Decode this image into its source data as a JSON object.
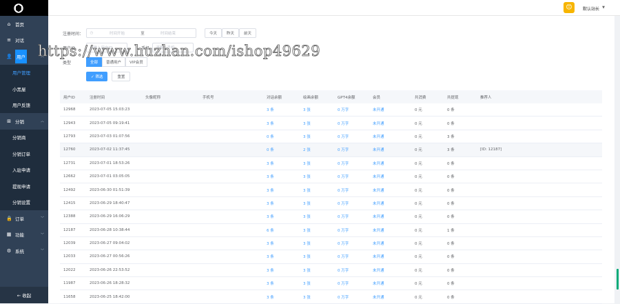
{
  "sidebar": {
    "items": [
      {
        "icon": "home-icon",
        "glyph": "⌂",
        "label": "首页"
      },
      {
        "icon": "list-icon",
        "glyph": "≡",
        "label": "对话"
      },
      {
        "icon": "user-icon",
        "glyph": "👤",
        "label": "用户",
        "expanded": true
      },
      {
        "icon": "distribution-icon",
        "glyph": "⊞",
        "label": "分销",
        "expanded": true
      },
      {
        "icon": "order-icon",
        "glyph": "🔒",
        "label": "订单"
      },
      {
        "icon": "function-icon",
        "glyph": "▦",
        "label": "功能"
      },
      {
        "icon": "system-icon",
        "glyph": "⚙",
        "label": "系统"
      }
    ],
    "user_sub": [
      "用户管理",
      "小黑屋",
      "用户反馈"
    ],
    "dist_sub": [
      "分销商",
      "分销订单",
      "入驻申请",
      "提现申请",
      "分销设置"
    ],
    "collapse_label": "← 收起"
  },
  "header": {
    "avatar_glyph": "😊",
    "username": "默认站长",
    "dropdown_glyph": "▼"
  },
  "filter": {
    "reg_time_label": "注册时间：",
    "start_placeholder": "时间开始",
    "separator": "至",
    "end_placeholder": "时间结束",
    "quick": [
      "今天",
      "昨天",
      "前天"
    ],
    "uid_label": "用户ID",
    "uid_placeholder": "请输入用户ID",
    "phone_label": "手机",
    "phone_placeholder": "请输入手机",
    "type_label": "类型",
    "type_options": [
      "全部",
      "普通用户",
      "VIP会员"
    ],
    "search_label": "✓ 筛选",
    "reset_label": "重置"
  },
  "watermark": "https://www.huzhan.com/ishop49629",
  "table": {
    "headers": [
      "用户ID",
      "注册时间",
      "头像昵称",
      "手机号",
      "对话余额",
      "绘画余额",
      "GPT4余额",
      "会员",
      "共消费",
      "共提现",
      "推荐人"
    ],
    "rows": [
      [
        "12968",
        "2023-07-05 15:03:23",
        "",
        "",
        "3 条",
        "3 张",
        "0 万字",
        "未开通",
        "0 元",
        "0 条",
        ""
      ],
      [
        "12943",
        "2023-07-05 09:19:41",
        "",
        "",
        "3 条",
        "3 张",
        "0 万字",
        "未开通",
        "0 元",
        "0 条",
        ""
      ],
      [
        "12793",
        "2023-07-03 01:07:56",
        "",
        "",
        "0 条",
        "3 张",
        "0 万字",
        "未开通",
        "0 元",
        "3 条",
        ""
      ],
      [
        "12760",
        "2023-07-02 11:37:45",
        "",
        "",
        "0 条",
        "2 张",
        "0 万字",
        "未开通",
        "0 元",
        "3 条",
        "[ID: 12187]"
      ],
      [
        "12731",
        "2023-07-01 18:53:26",
        "",
        "",
        "3 条",
        "3 张",
        "0 万字",
        "未开通",
        "0 元",
        "0 条",
        ""
      ],
      [
        "12662",
        "2023-07-01 03:05:05",
        "",
        "",
        "3 条",
        "3 张",
        "0 万字",
        "未开通",
        "0 元",
        "0 条",
        ""
      ],
      [
        "12492",
        "2023-06-30 01:51:39",
        "",
        "",
        "3 条",
        "3 张",
        "0 万字",
        "未开通",
        "0 元",
        "0 条",
        ""
      ],
      [
        "12415",
        "2023-06-29 18:40:47",
        "",
        "",
        "3 条",
        "3 张",
        "0 万字",
        "未开通",
        "0 元",
        "0 条",
        ""
      ],
      [
        "12388",
        "2023-06-29 16:06:29",
        "",
        "",
        "3 条",
        "3 张",
        "0 万字",
        "未开通",
        "0 元",
        "0 条",
        ""
      ],
      [
        "12187",
        "2023-06-28 10:38:44",
        "",
        "",
        "6 条",
        "3 张",
        "0 万字",
        "未开通",
        "0 元",
        "1 条",
        ""
      ],
      [
        "12039",
        "2023-06-27 09:04:02",
        "",
        "",
        "3 条",
        "3 张",
        "0 万字",
        "未开通",
        "0 元",
        "0 条",
        ""
      ],
      [
        "12033",
        "2023-06-27 00:56:26",
        "",
        "",
        "3 条",
        "3 张",
        "0 万字",
        "未开通",
        "0 元",
        "0 条",
        ""
      ],
      [
        "12022",
        "2023-06-26 22:53:52",
        "",
        "",
        "3 条",
        "3 张",
        "0 万字",
        "未开通",
        "0 元",
        "0 条",
        ""
      ],
      [
        "11987",
        "2023-06-26 18:28:32",
        "",
        "",
        "3 条",
        "3 张",
        "0 万字",
        "未开通",
        "0 元",
        "0 条",
        ""
      ],
      [
        "11658",
        "2023-06-25 18:42:00",
        "",
        "",
        "3 条",
        "3 张",
        "0 万字",
        "未开通",
        "0 元",
        "0 条",
        ""
      ]
    ]
  }
}
